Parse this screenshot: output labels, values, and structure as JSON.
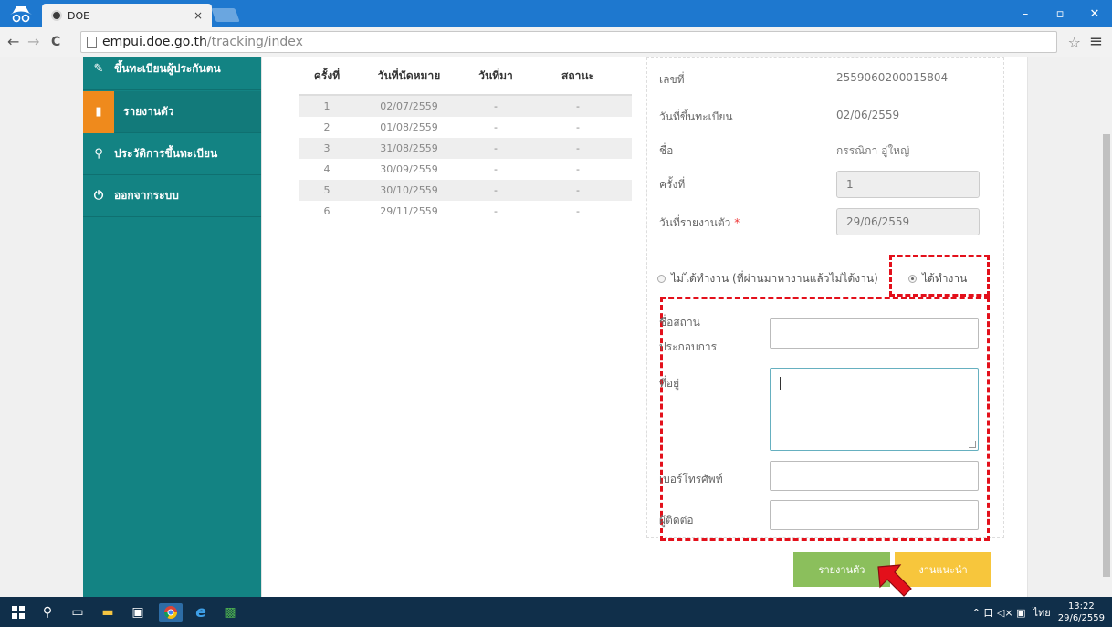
{
  "browser": {
    "tab_title": "DOE",
    "tab_close": "×",
    "url_host": "empui.doe.go.th",
    "url_path": "/tracking/index",
    "back": "←",
    "forward": "→",
    "reload": "C",
    "star": "☆",
    "menu": "≡",
    "window_min": "–",
    "window_max": "▫",
    "window_close": "✕"
  },
  "sidebar": {
    "items": [
      {
        "icon": "edit-icon",
        "glyph": "✎",
        "label": "ขึ้นทะเบียนผู้ประกันตน"
      },
      {
        "icon": "report-icon",
        "glyph": "▮",
        "label": "รายงานตัว"
      },
      {
        "icon": "search-icon",
        "glyph": "⚲",
        "label": "ประวัติการขึ้นทะเบียน"
      },
      {
        "icon": "power-icon",
        "glyph": "⏻",
        "label": "ออกจากระบบ"
      }
    ]
  },
  "history": {
    "headers": [
      "ครั้งที่",
      "วันที่นัดหมาย",
      "วันที่มา",
      "สถานะ"
    ],
    "rows": [
      [
        "1",
        "02/07/2559",
        "-",
        "-"
      ],
      [
        "2",
        "01/08/2559",
        "-",
        "-"
      ],
      [
        "3",
        "31/08/2559",
        "-",
        "-"
      ],
      [
        "4",
        "30/09/2559",
        "-",
        "-"
      ],
      [
        "5",
        "30/10/2559",
        "-",
        "-"
      ],
      [
        "6",
        "29/11/2559",
        "-",
        "-"
      ]
    ]
  },
  "form": {
    "number_label": "เลขที่",
    "number_value": "2559060200015804",
    "reg_date_label": "วันที่ขึ้นทะเบียน",
    "reg_date_value": "02/06/2559",
    "name_label": "ชื่อ",
    "name_value": "กรรณิกา อู่ใหญ่",
    "round_label": "ครั้งที่",
    "round_value": "1",
    "report_date_label": "วันที่รายงานตัว",
    "report_date_required": "*",
    "report_date_value": "29/06/2559",
    "radio_not_working": "ไม่ได้ทำงาน (ที่ผ่านมาหางานแล้วไม่ได้งาน)",
    "radio_working": "ได้ทำงาน",
    "business_name_label_1": "ชื่อสถาน",
    "business_name_label_2": "ประกอบการ",
    "address_label": "ที่อยู่",
    "phone_label": "เบอร์โทรศัพท์",
    "contact_label": "ผู้ติดต่อ",
    "business_name_value": "",
    "address_value": "",
    "phone_value": "",
    "contact_value": ""
  },
  "buttons": {
    "report": "รายงานตัว",
    "guide": "งานแนะนำ"
  },
  "taskbar": {
    "clock_time": "13:22",
    "clock_date": "29/6/2559",
    "lang": "ไทย",
    "tray_icons": "^ 口 ◁× ▣"
  },
  "colors": {
    "sidebar": "#138383",
    "active_icon": "#ef8a1c",
    "report_button": "#8bbf5c",
    "guide_button": "#f7c63c",
    "highlight": "#e3101b"
  }
}
